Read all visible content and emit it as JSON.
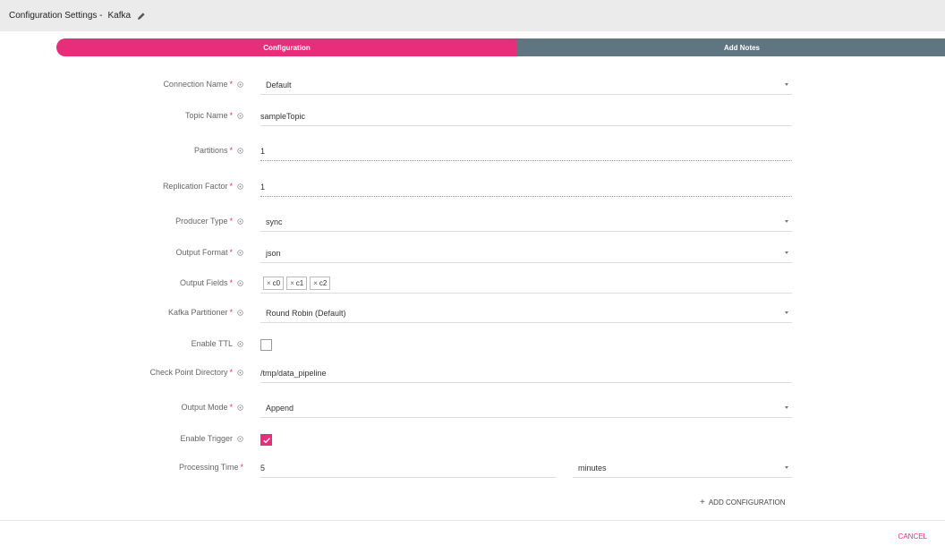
{
  "header": {
    "title": "Configuration Settings -",
    "entity": "Kafka",
    "edit_icon": "pencil-icon"
  },
  "stepper": {
    "step1": "Configuration",
    "step2": "Add Notes"
  },
  "colors": {
    "accent": "#e62e7b",
    "step_inactive": "#5f7580"
  },
  "form": {
    "connection_name": {
      "label": "Connection Name",
      "value": "Default"
    },
    "topic_name": {
      "label": "Topic Name",
      "value": "sampleTopic"
    },
    "partitions": {
      "label": "Partitions",
      "value": "1"
    },
    "replication_factor": {
      "label": "Replication Factor",
      "value": "1"
    },
    "producer_type": {
      "label": "Producer Type",
      "value": "sync"
    },
    "output_format": {
      "label": "Output Format",
      "value": "json"
    },
    "output_fields": {
      "label": "Output Fields",
      "chips": [
        "c0",
        "c1",
        "c2"
      ]
    },
    "kafka_partitioner": {
      "label": "Kafka Partitioner",
      "value": "Round Robin (Default)"
    },
    "enable_ttl": {
      "label": "Enable TTL",
      "checked": false
    },
    "checkpoint_dir": {
      "label": "Check Point Directory",
      "value": "/tmp/data_pipeline"
    },
    "output_mode": {
      "label": "Output Mode",
      "value": "Append"
    },
    "enable_trigger": {
      "label": "Enable Trigger",
      "checked": true
    },
    "processing_time": {
      "label": "Processing Time",
      "value": "5",
      "unit": "minutes"
    }
  },
  "actions": {
    "add_configuration": "ADD CONFIGURATION",
    "cancel": "CANCEL"
  },
  "symbols": {
    "required": "*",
    "remove": "×"
  }
}
